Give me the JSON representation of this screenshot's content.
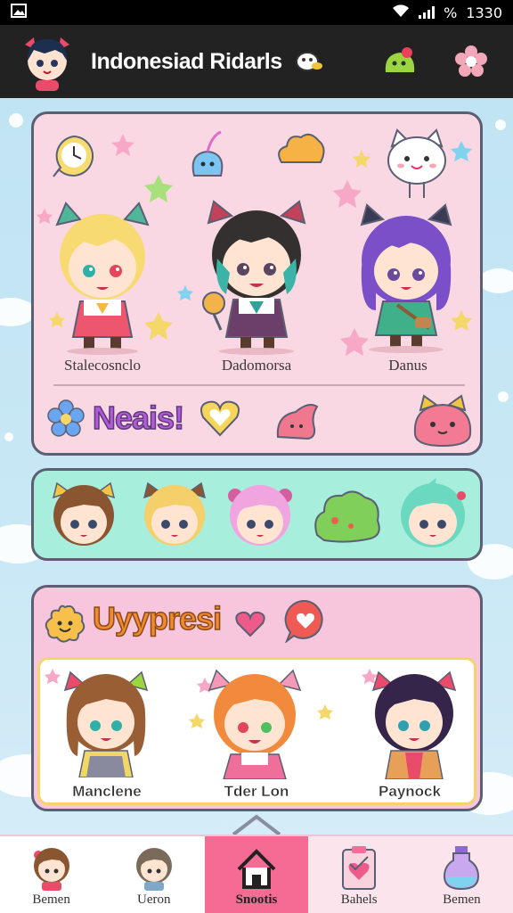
{
  "status_bar": {
    "battery": "%",
    "time": "1330"
  },
  "header": {
    "title": "Indonesiad Ridarls"
  },
  "featured": {
    "names": [
      "Stalecosnclo",
      "Dadomorsa",
      "Danus"
    ],
    "title": "Neais!"
  },
  "section2": {
    "title": "Uyypresi",
    "names": [
      "Manclene",
      "Tder Lon",
      "Paynock"
    ]
  },
  "nav": {
    "items": [
      {
        "label": "Bemen"
      },
      {
        "label": "Ueron"
      },
      {
        "label": "Snootis"
      },
      {
        "label": "Bahels"
      },
      {
        "label": "Bemen"
      }
    ],
    "active_index": 2
  },
  "colors": {
    "accent": "#f56b93",
    "panel_pink": "#f9d7e3",
    "panel_mint": "#a8eedd",
    "title_purple": "#b35ad8",
    "title_orange": "#f08a2c"
  }
}
